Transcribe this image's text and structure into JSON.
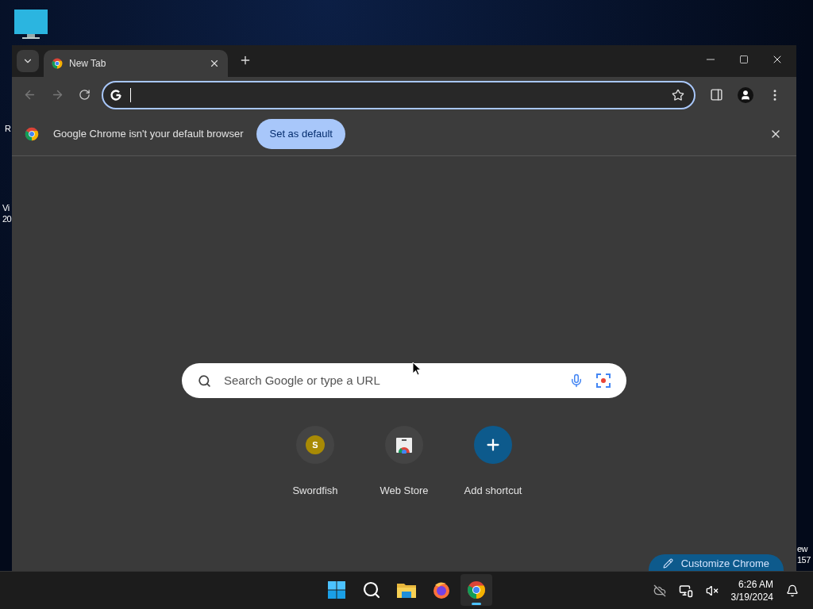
{
  "desktop": {
    "labels": [
      {
        "lines": [
          "R"
        ]
      },
      {
        "lines": [
          "Vi",
          "20"
        ]
      },
      {
        "lines": [
          "ew",
          "157"
        ]
      }
    ]
  },
  "browser": {
    "tabs": [
      {
        "title": "New Tab",
        "selected": true
      }
    ],
    "infobar": {
      "message": "Google Chrome isn't your default browser",
      "button": "Set as default"
    },
    "search": {
      "placeholder": "Search Google or type a URL"
    },
    "shortcuts": [
      {
        "kind": "letter",
        "letter": "S",
        "title": "Swordfish"
      },
      {
        "kind": "store",
        "title": "Web Store"
      },
      {
        "kind": "add",
        "title": "Add shortcut"
      }
    ],
    "customize_button": "Customize Chrome"
  },
  "taskbar": {
    "apps": [
      {
        "kind": "start",
        "selected": false
      },
      {
        "kind": "search",
        "selected": false
      },
      {
        "kind": "files",
        "selected": false
      },
      {
        "kind": "firefox",
        "selected": false
      },
      {
        "kind": "chrome",
        "selected": true
      }
    ],
    "time": "6:26 AM",
    "date": "3/19/2024"
  }
}
